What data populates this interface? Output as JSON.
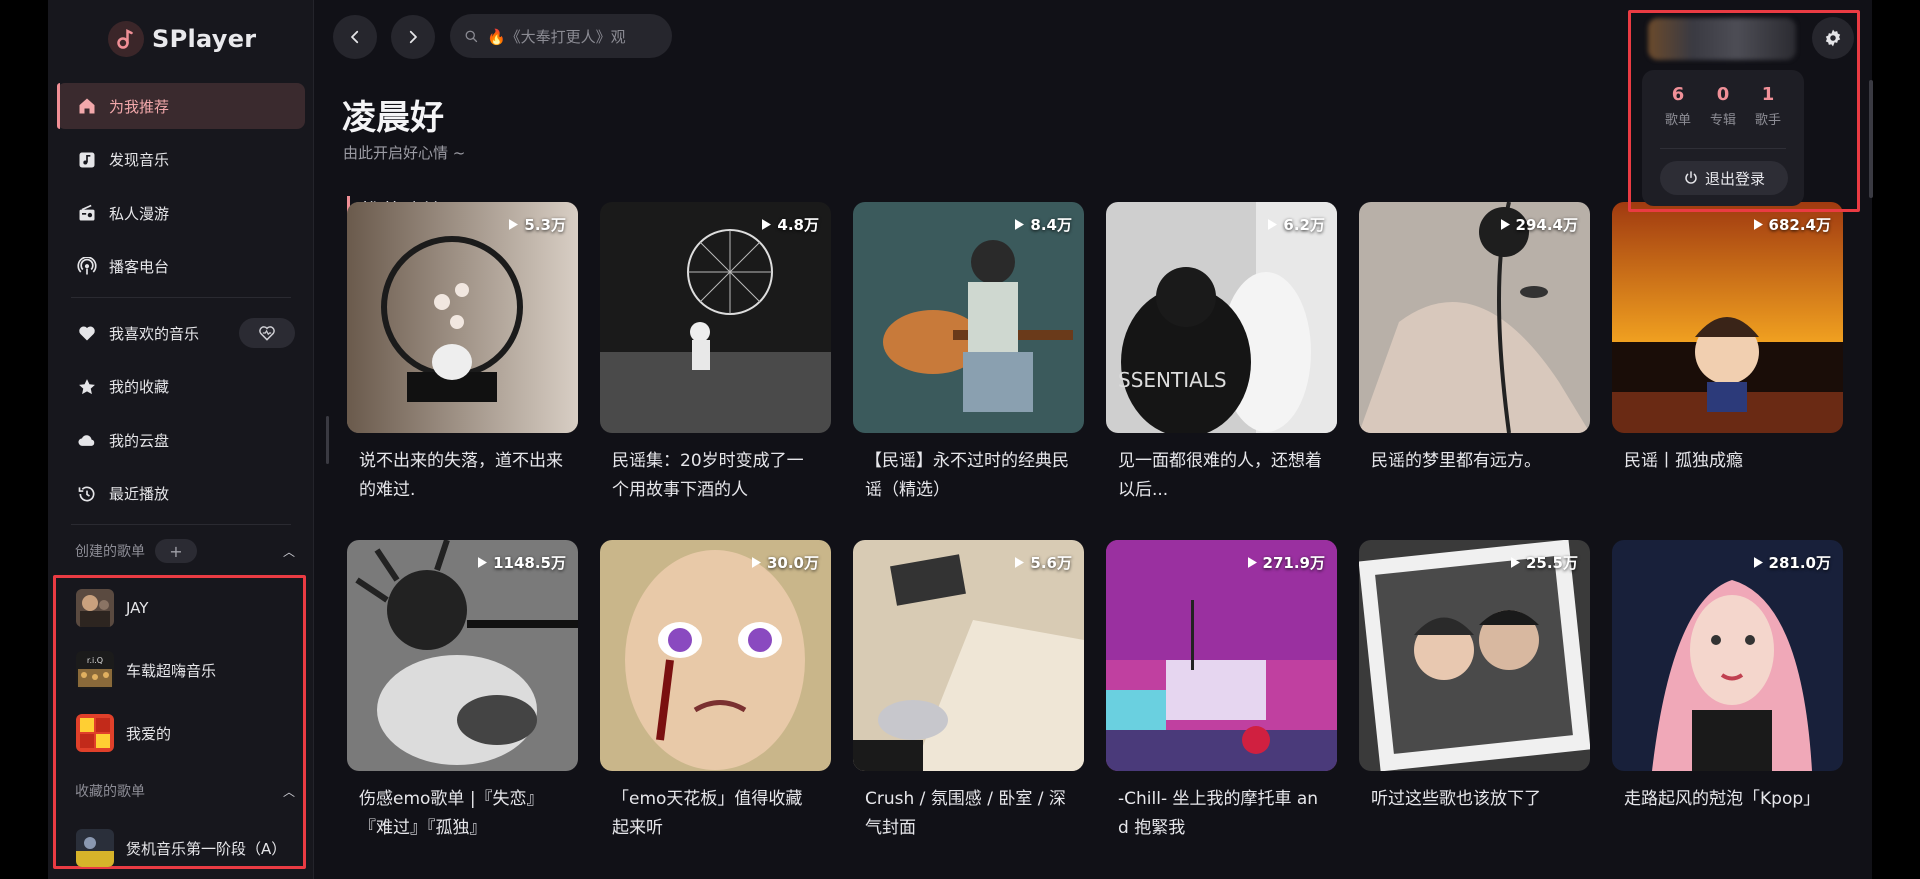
{
  "app": {
    "name": "SPlayer"
  },
  "search": {
    "placeholder": "🔥《大奉打更人》观"
  },
  "nav": {
    "items": [
      {
        "label": "为我推荐",
        "icon": "home-icon",
        "active": true
      },
      {
        "label": "发现音乐",
        "icon": "music-note-icon"
      },
      {
        "label": "私人漫游",
        "icon": "radio-icon"
      },
      {
        "label": "播客电台",
        "icon": "podcast-icon"
      }
    ],
    "library": [
      {
        "label": "我喜欢的音乐",
        "icon": "heart-icon"
      },
      {
        "label": "我的收藏",
        "icon": "star-icon"
      },
      {
        "label": "我的云盘",
        "icon": "cloud-icon"
      },
      {
        "label": "最近播放",
        "icon": "history-icon"
      }
    ]
  },
  "created_playlists": {
    "title": "创建的歌单",
    "add_label": "+",
    "items": [
      {
        "name": "JAY"
      },
      {
        "name": "车载超嗨音乐"
      },
      {
        "name": "我爱的"
      }
    ]
  },
  "collected_playlists": {
    "title": "收藏的歌单",
    "items": [
      {
        "name": "煲机音乐第一阶段（A）"
      }
    ]
  },
  "greeting": {
    "title": "凌晨好",
    "subtitle": "由此开启好心情 ~"
  },
  "section": {
    "title": "推荐歌单"
  },
  "playlists": [
    {
      "title": "说不出来的失落，道不出来的难过.",
      "plays": "5.3万"
    },
    {
      "title": "民谣集：20岁时变成了一个用故事下酒的人",
      "plays": "4.8万"
    },
    {
      "title": "【民谣】永不过时的经典民谣（精选）",
      "plays": "8.4万"
    },
    {
      "title": "见一面都很难的人，还想着以后...",
      "plays": "6.2万"
    },
    {
      "title": "民谣的梦里都有远方。",
      "plays": "294.4万"
    },
    {
      "title": "民谣丨孤独成瘾",
      "plays": "682.4万"
    },
    {
      "title": "伤感emo歌单 |『失恋』『难过』『孤独』",
      "plays": "1148.5万"
    },
    {
      "title": "「emo天花板」值得收藏起来听",
      "plays": "30.0万"
    },
    {
      "title": "Crush / 氛围感 / 卧室 / 深气封面",
      "plays": "5.6万"
    },
    {
      "title": "-Chill- 坐上我的摩托車 and 抱緊我",
      "plays": "271.9万"
    },
    {
      "title": "听过这些歌也该放下了",
      "plays": "25.5万"
    },
    {
      "title": "走路起风的尅泡「Kpop」",
      "plays": "281.0万"
    }
  ],
  "user": {
    "stats": [
      {
        "num": "6",
        "label": "歌单"
      },
      {
        "num": "0",
        "label": "专辑"
      },
      {
        "num": "1",
        "label": "歌手"
      }
    ],
    "logout_label": "退出登录"
  },
  "colors": {
    "accent": "#f08f96",
    "highlight_box": "#ea3b43",
    "background": "#111117"
  }
}
